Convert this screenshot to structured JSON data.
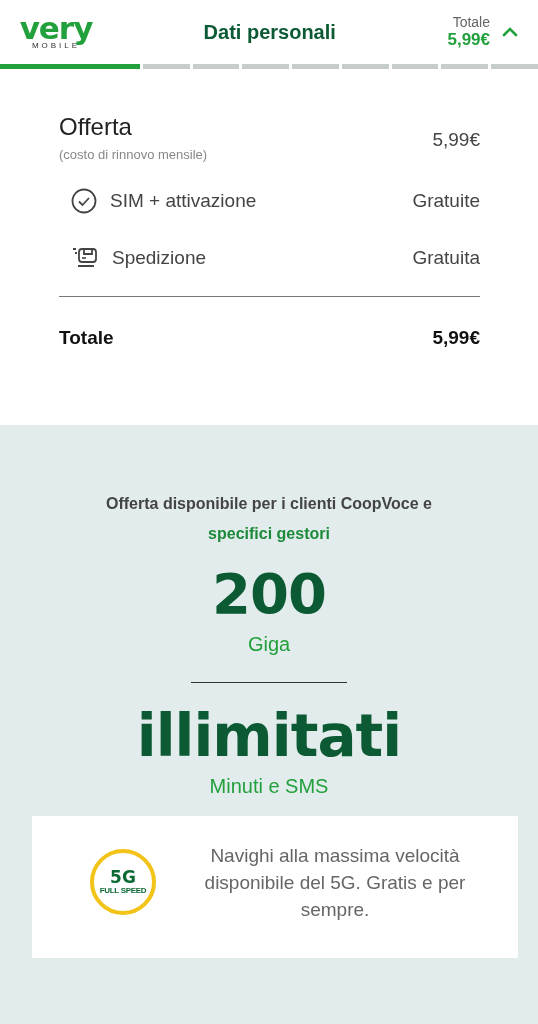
{
  "header": {
    "logo": {
      "wordmark": "very",
      "tagline": "MOBILE"
    },
    "title": "Dati personali",
    "total_label": "Totale",
    "total_value": "5,99€",
    "expanded": true
  },
  "progress": {
    "level": 0.26
  },
  "summary": {
    "offer": {
      "title": "Offerta",
      "note": "(costo di rinnovo mensile)",
      "price": "5,99€"
    },
    "items": [
      {
        "kind": "check",
        "label": "SIM + attivazione",
        "value": "Gratuite"
      },
      {
        "kind": "shipping",
        "label": "Spedizione",
        "value": "Gratuita"
      }
    ],
    "total": {
      "label": "Totale",
      "value": "5,99€"
    }
  },
  "promo": {
    "intro": "Offerta disponibile per i clienti CoopVoce e **specifici gestori**",
    "data_amount": "200",
    "data_unit": "Giga",
    "voice_amount": "illimitati",
    "voice_unit": "Minuti e SMS",
    "feature": {
      "badge_top": "5G",
      "badge_bottom": "FULL SPEED",
      "text": "Navighi alla massima velocità disponibile del 5G. Gratis e per sempre."
    }
  }
}
